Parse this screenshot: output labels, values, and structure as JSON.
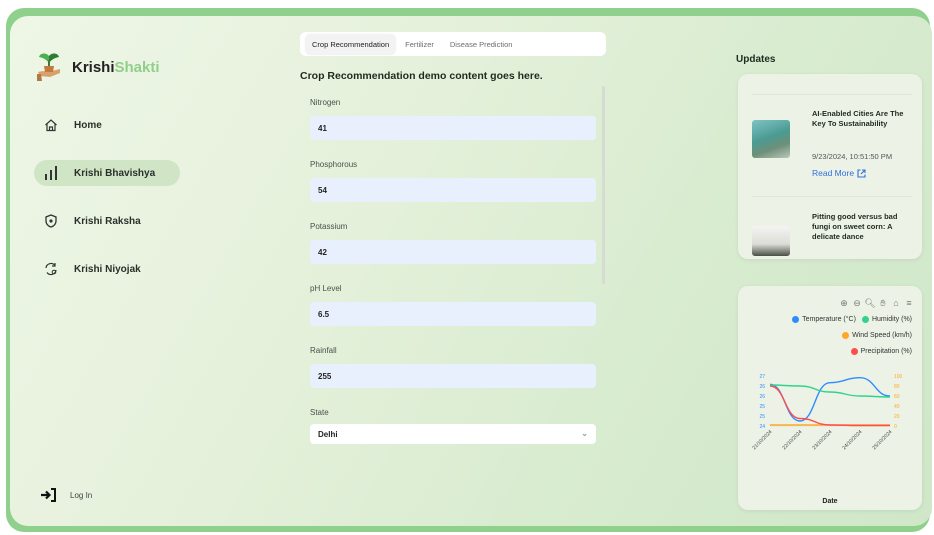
{
  "brand": {
    "name_part1": "Krishi",
    "name_part2": "Shakti"
  },
  "sidebar": {
    "items": [
      {
        "label": "Home",
        "icon": "home-icon",
        "active": false
      },
      {
        "label": "Krishi Bhavishya",
        "icon": "bar-chart-icon",
        "active": true
      },
      {
        "label": "Krishi Raksha",
        "icon": "shield-icon",
        "active": false
      },
      {
        "label": "Krishi Niyojak",
        "icon": "refresh-gear-icon",
        "active": false
      }
    ],
    "login_label": "Log In"
  },
  "tabs": [
    {
      "label": "Crop Recommendation",
      "active": true
    },
    {
      "label": "Fertilizer",
      "active": false
    },
    {
      "label": "Disease Prediction",
      "active": false
    }
  ],
  "content_title": "Crop Recommendation demo content goes here.",
  "form": {
    "nitrogen": {
      "label": "Nitrogen",
      "value": "41"
    },
    "phosphorous": {
      "label": "Phosphorous",
      "value": "54"
    },
    "potassium": {
      "label": "Potassium",
      "value": "42"
    },
    "ph": {
      "label": "pH Level",
      "value": "6.5"
    },
    "rainfall": {
      "label": "Rainfall",
      "value": "255"
    },
    "state": {
      "label": "State",
      "value": "Delhi"
    }
  },
  "updates": {
    "title": "Updates",
    "news": [
      {
        "title": "AI-Enabled Cities Are The Key To Sustainability",
        "date": "9/23/2024, 10:51:50 PM",
        "link_label": "Read More"
      },
      {
        "title": "Pitting good versus bad fungi on sweet corn: A delicate dance"
      }
    ]
  },
  "chart_data": {
    "type": "line",
    "xlabel": "Date",
    "x": [
      "21/10/2024",
      "22/10/2024",
      "23/10/2024",
      "24/10/2024",
      "25/10/2024"
    ],
    "legend_placement": "top-right",
    "series": [
      {
        "name": "Temperature (°C)",
        "color": "#2f8cff",
        "axis": "left",
        "values": [
          26.5,
          24.3,
          26.6,
          26.9,
          25.8
        ]
      },
      {
        "name": "Humidity (%)",
        "color": "#2fd48a",
        "axis": "right",
        "values": [
          82,
          80,
          68,
          60,
          58
        ]
      },
      {
        "name": "Wind Speed (km/h)",
        "color": "#ffa726",
        "axis": "right",
        "values": [
          2,
          2,
          2,
          2,
          2
        ]
      },
      {
        "name": "Precipitation (%)",
        "color": "#ff4d4f",
        "axis": "right",
        "values": [
          80,
          15,
          2,
          1,
          1
        ]
      }
    ],
    "left_ticks": [
      "27",
      "26",
      "26",
      "25",
      "25",
      "24"
    ],
    "right_ticks": [
      "100",
      "80",
      "60",
      "40",
      "20",
      "0"
    ],
    "left_ylim": [
      24,
      27
    ],
    "right_ylim": [
      0,
      100
    ]
  }
}
